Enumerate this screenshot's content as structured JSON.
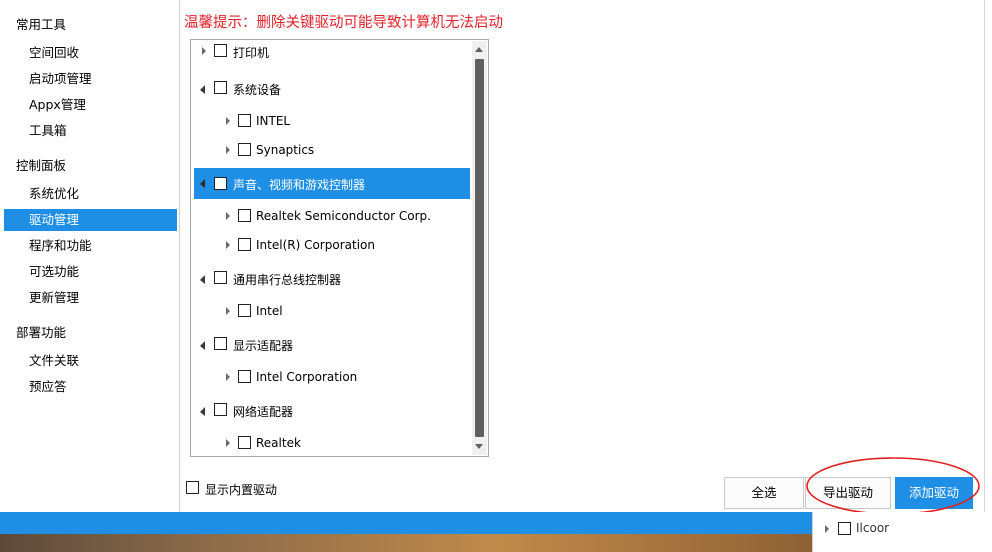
{
  "sidebar": {
    "groups": [
      {
        "label": "常用工具",
        "items": [
          "空间回收",
          "启动项管理",
          "Appx管理",
          "工具箱"
        ]
      },
      {
        "label": "控制面板",
        "items": [
          "系统优化",
          "驱动管理",
          "程序和功能",
          "可选功能",
          "更新管理"
        ]
      },
      {
        "label": "部署功能",
        "items": [
          "文件关联",
          "预应答"
        ]
      }
    ],
    "active_item": "驱动管理"
  },
  "warning": "温馨提示：删除关键驱动可能导致计算机无法启动",
  "tree": {
    "nodes": [
      {
        "label": "打印机",
        "level": 0,
        "expander": "collapsed",
        "checked": false
      },
      {
        "label": "系统设备",
        "level": 0,
        "expander": "expanded",
        "checked": false
      },
      {
        "label": "INTEL",
        "level": 1,
        "expander": "collapsed",
        "checked": false
      },
      {
        "label": "Synaptics",
        "level": 1,
        "expander": "collapsed",
        "checked": false
      },
      {
        "label": "声音、视频和游戏控制器",
        "level": 0,
        "expander": "expanded",
        "checked": false,
        "selected": true
      },
      {
        "label": "Realtek Semiconductor Corp.",
        "level": 1,
        "expander": "collapsed",
        "checked": false
      },
      {
        "label": "Intel(R) Corporation",
        "level": 1,
        "expander": "collapsed",
        "checked": false
      },
      {
        "label": "通用串行总线控制器",
        "level": 0,
        "expander": "expanded",
        "checked": false
      },
      {
        "label": "Intel",
        "level": 1,
        "expander": "collapsed",
        "checked": false
      },
      {
        "label": "显示适配器",
        "level": 0,
        "expander": "expanded",
        "checked": false
      },
      {
        "label": "Intel Corporation",
        "level": 1,
        "expander": "collapsed",
        "checked": false
      },
      {
        "label": "网络适配器",
        "level": 0,
        "expander": "expanded",
        "checked": false
      },
      {
        "label": "Realtek",
        "level": 1,
        "expander": "collapsed",
        "checked": false
      }
    ]
  },
  "show_builtin_label": "显示内置驱动",
  "buttons": {
    "select_all": "全选",
    "export": "导出驱动",
    "add": "添加驱动"
  },
  "ghost_item_label": "Ilcoor",
  "colors": {
    "accent": "#1f8fe5",
    "warning": "#e2242b",
    "annotation": "#e02020"
  }
}
